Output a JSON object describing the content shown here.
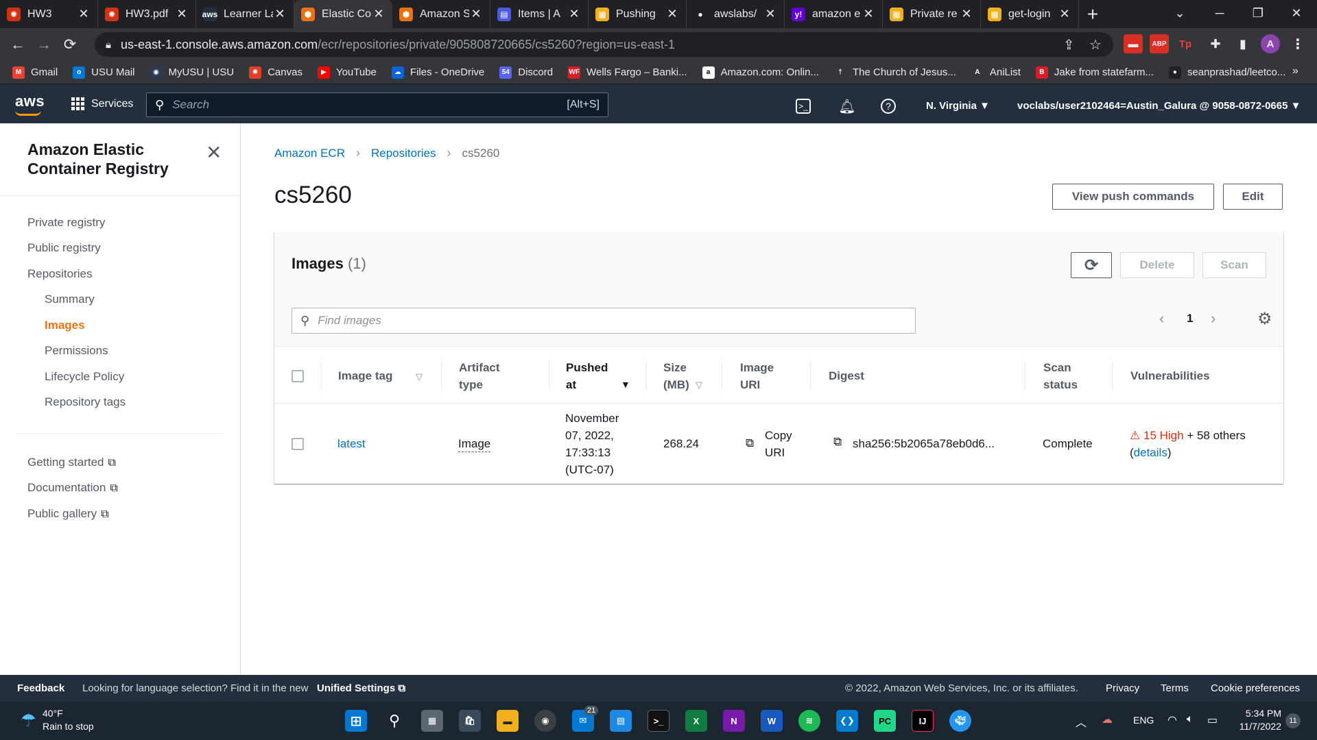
{
  "browser": {
    "tabs": [
      {
        "title": "HW3",
        "color": "#d13212",
        "glyph": "✺"
      },
      {
        "title": "HW3.pdf",
        "color": "#d13212",
        "glyph": "✺"
      },
      {
        "title": "Learner Lab",
        "color": "#232f3e",
        "glyph": "aws"
      },
      {
        "title": "Elastic Co",
        "color": "#ec7211",
        "glyph": "⬢"
      },
      {
        "title": "Amazon S",
        "color": "#ec7211",
        "glyph": "⬢"
      },
      {
        "title": "Items | A",
        "color": "#4b5bdc",
        "glyph": "▤"
      },
      {
        "title": "Pushing",
        "color": "#f2b01e",
        "glyph": "▦"
      },
      {
        "title": "awslabs/",
        "color": "#202124",
        "glyph": "●"
      },
      {
        "title": "amazon e",
        "color": "#6001d2",
        "glyph": "y!"
      },
      {
        "title": "Private re",
        "color": "#f2b01e",
        "glyph": "▦"
      },
      {
        "title": "get-login",
        "color": "#f2b01e",
        "glyph": "▦"
      }
    ],
    "url_host": "us-east-1.console.aws.amazon.com",
    "url_path": "/ecr/repositories/private/905808720665/cs5260?region=us-east-1",
    "profile_initial": "A",
    "bookmarks": [
      {
        "label": "Gmail",
        "color": "#ea4335",
        "glyph": "M"
      },
      {
        "label": "USU Mail",
        "color": "#0078d4",
        "glyph": "o"
      },
      {
        "label": "MyUSU | USU",
        "color": "#2a3a55",
        "glyph": "◉"
      },
      {
        "label": "Canvas",
        "color": "#e13f2b",
        "glyph": "✺"
      },
      {
        "label": "YouTube",
        "color": "#ff0000",
        "glyph": "▶"
      },
      {
        "label": "Files - OneDrive",
        "color": "#0a64d8",
        "glyph": "☁"
      },
      {
        "label": "Discord",
        "color": "#5865f2",
        "glyph": "54"
      },
      {
        "label": "Wells Fargo – Banki...",
        "color": "#d71e28",
        "glyph": "WF"
      },
      {
        "label": "Amazon.com: Onlin...",
        "color": "#ffffff",
        "glyph": "a"
      },
      {
        "label": "The Church of Jesus...",
        "color": "#35363a",
        "glyph": "†"
      },
      {
        "label": "AniList",
        "color": "#35363a",
        "glyph": "A"
      },
      {
        "label": "Jake from statefarm...",
        "color": "#d71e28",
        "glyph": "B"
      },
      {
        "label": "seanprashad/leetco...",
        "color": "#202124",
        "glyph": "●"
      }
    ]
  },
  "aws": {
    "logo": "aws",
    "services_label": "Services",
    "search_placeholder": "Search",
    "search_shortcut": "[Alt+S]",
    "region": "N. Virginia ▼",
    "account": "voclabs/user2102464=Austin_Galura @ 9058-0872-0665 ▼"
  },
  "sidebar": {
    "title": "Amazon Elastic Container Registry",
    "items": [
      {
        "label": "Private registry"
      },
      {
        "label": "Public registry"
      },
      {
        "label": "Repositories"
      },
      {
        "label": "Summary"
      },
      {
        "label": "Images"
      },
      {
        "label": "Permissions"
      },
      {
        "label": "Lifecycle Policy"
      },
      {
        "label": "Repository tags"
      }
    ],
    "links": [
      {
        "label": "Getting started"
      },
      {
        "label": "Documentation"
      },
      {
        "label": "Public gallery"
      }
    ]
  },
  "breadcrumb": {
    "root": "Amazon ECR",
    "parent": "Repositories",
    "current": "cs5260"
  },
  "page": {
    "title": "cs5260",
    "view_push_label": "View push commands",
    "edit_label": "Edit"
  },
  "images": {
    "title": "Images",
    "count": "(1)",
    "refresh_glyph": "⟳",
    "delete_label": "Delete",
    "scan_label": "Scan",
    "search_placeholder": "Find images",
    "page": "1",
    "columns": {
      "tag": "Image tag",
      "artifact": "Artifact type",
      "pushed": "Pushed at",
      "size": "Size (MB)",
      "uri": "Image URI",
      "digest": "Digest",
      "scan": "Scan status",
      "vuln": "Vulnerabilities"
    },
    "row": {
      "tag": "latest",
      "artifact": "Image",
      "pushed": "November 07, 2022, 17:33:13 (UTC-07)",
      "size": "268.24",
      "uri": "Copy URI",
      "digest": "sha256:5b2065a78eb0d6...",
      "scan": "Complete",
      "vuln_high": "15 High",
      "vuln_rest": " + 58 others",
      "vuln_open": "(",
      "vuln_link": "details",
      "vuln_close": ")"
    }
  },
  "footer": {
    "feedback": "Feedback",
    "language_text": "Looking for language selection? Find it in the new",
    "unified": "Unified Settings",
    "copyright": "© 2022, Amazon Web Services, Inc. or its affiliates.",
    "privacy": "Privacy",
    "terms": "Terms",
    "cookies": "Cookie preferences"
  },
  "taskbar": {
    "weather_temp": "40°F",
    "weather_desc": "Rain to stop",
    "mail_badge": "21",
    "lang": "ENG",
    "time": "5:34 PM",
    "date": "11/7/2022",
    "notif_count": "11"
  }
}
